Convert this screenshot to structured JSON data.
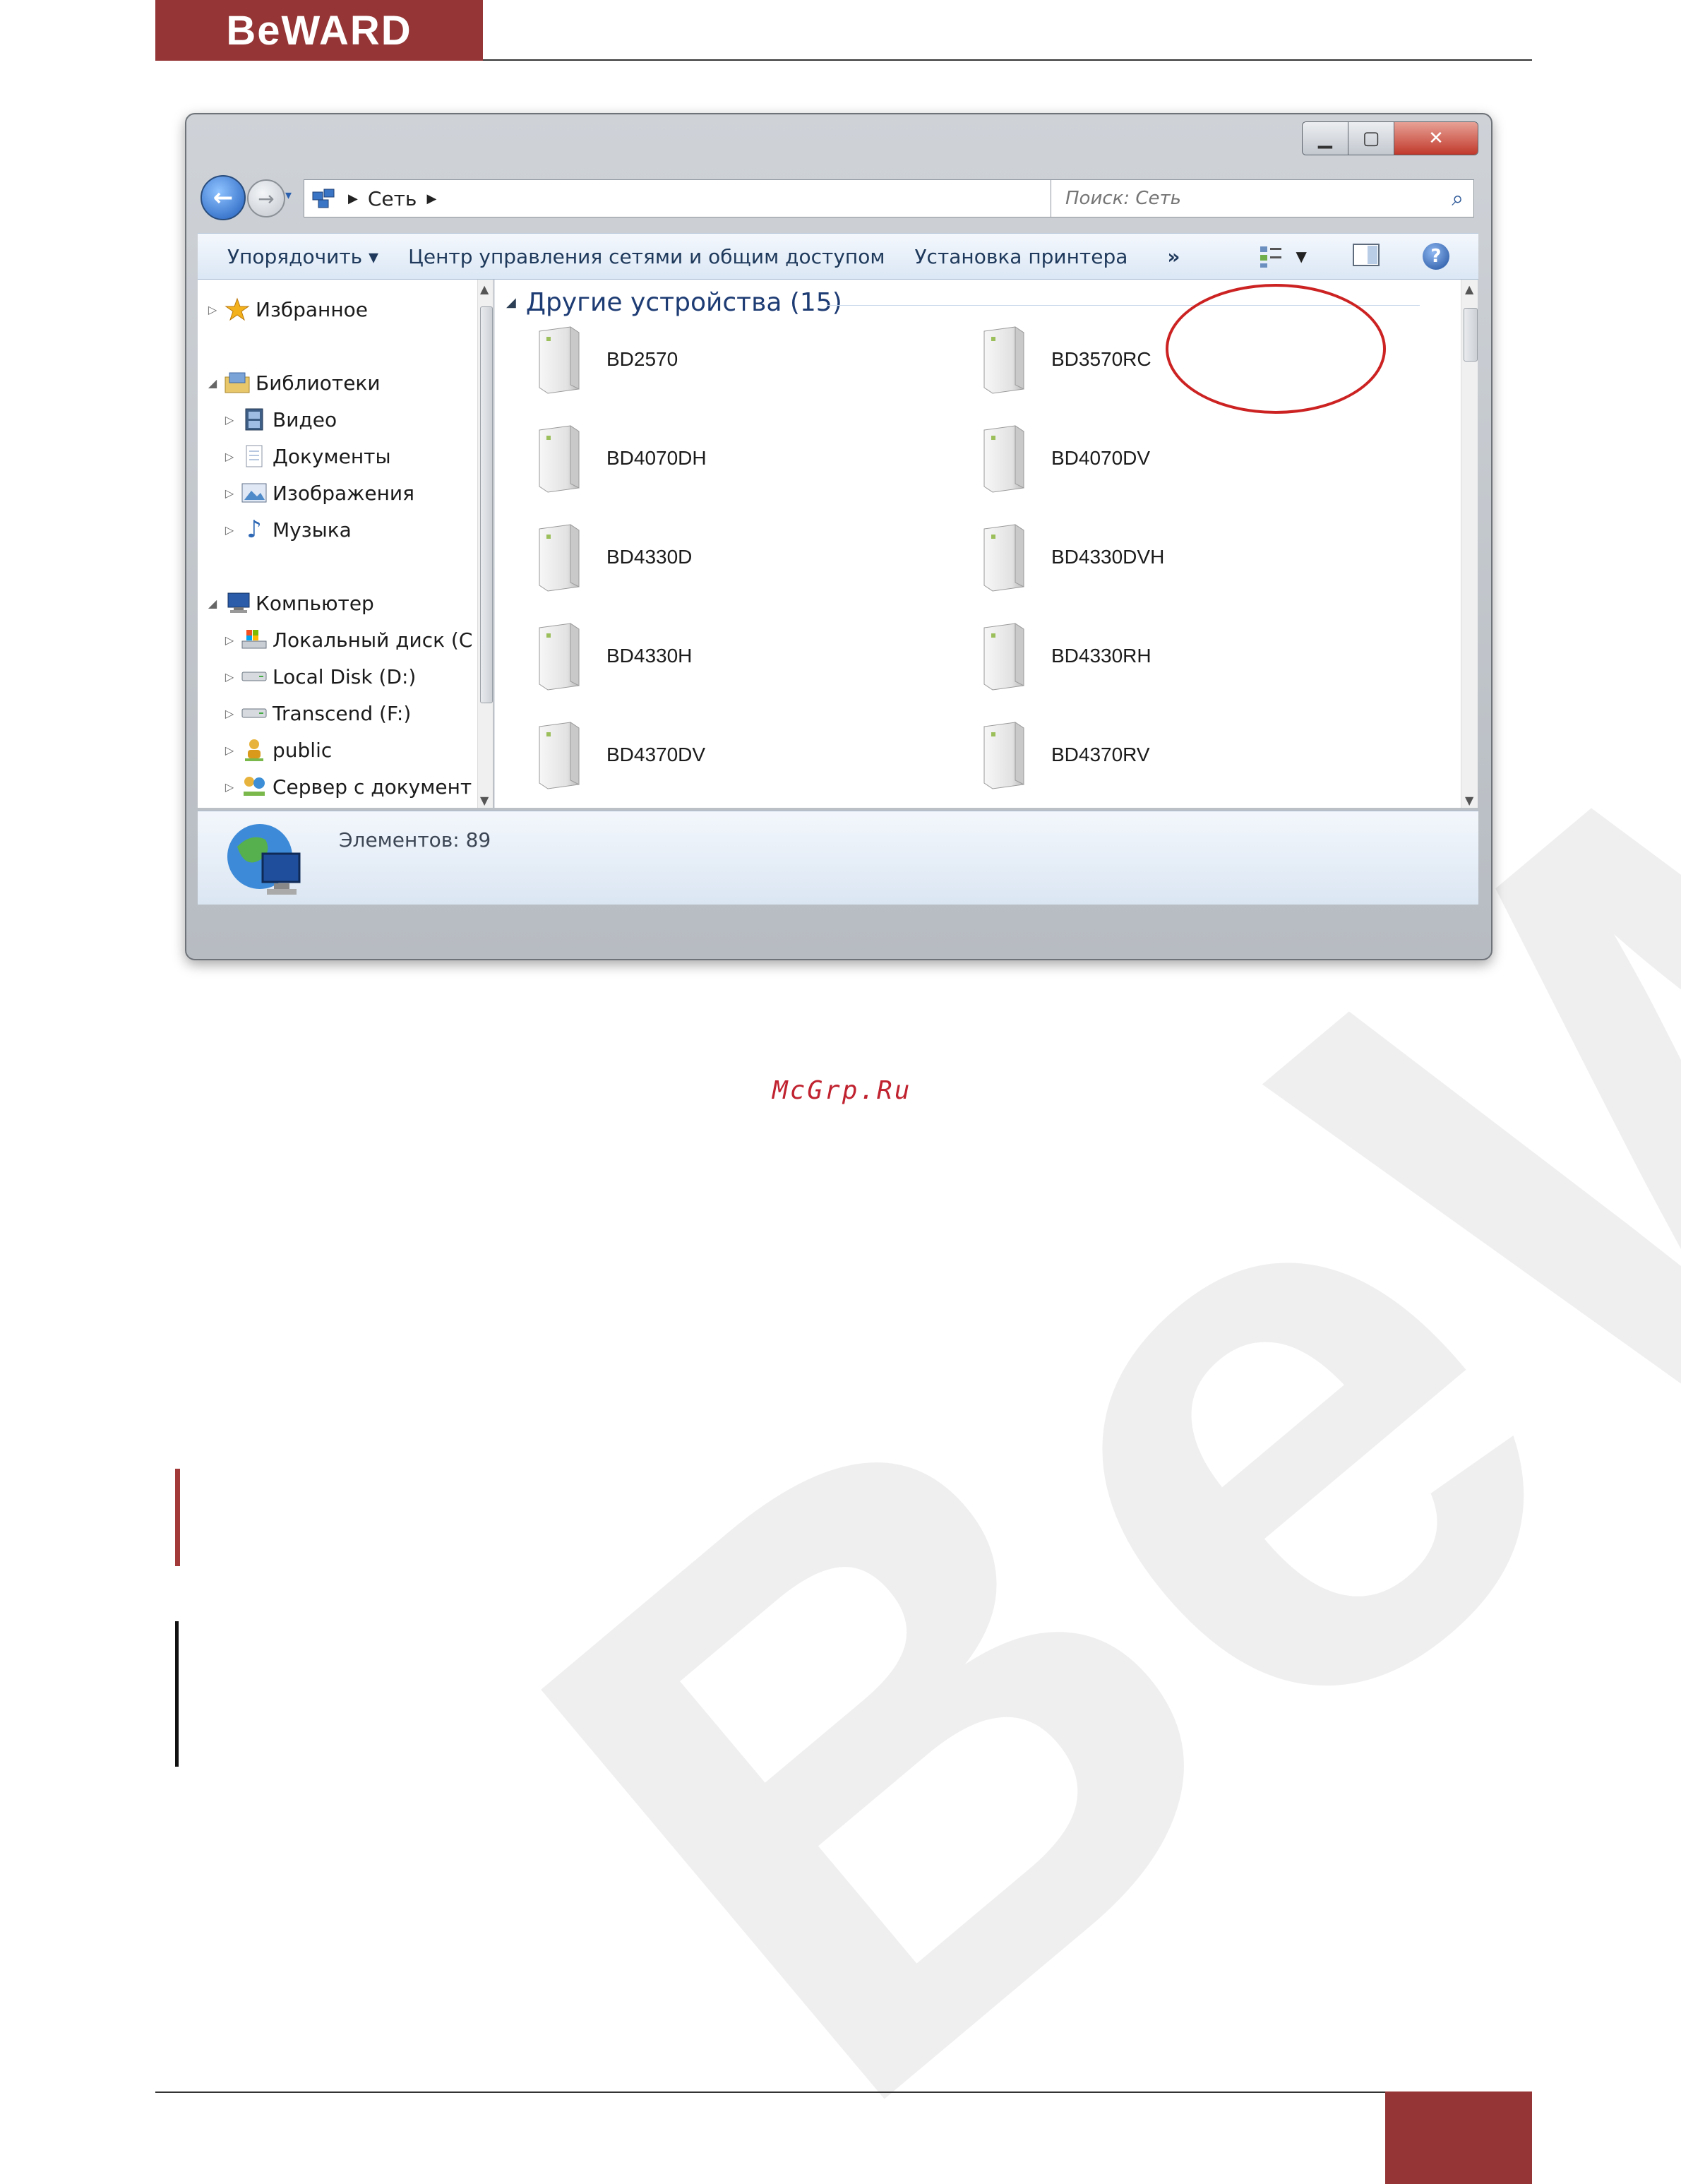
{
  "brand": {
    "logo_text": "BeWARD",
    "accent_color": "#953535"
  },
  "window": {
    "controls": {
      "minimize": "▁",
      "maximize": "▢",
      "close": "✕"
    },
    "nav": {
      "back_icon": "back-arrow-icon",
      "forward_icon": "forward-arrow-icon",
      "breadcrumb": "Сеть",
      "search_placeholder": "Поиск: Сеть"
    },
    "toolbar": {
      "organize": "Упорядочить ▾",
      "network_center": "Центр управления сетями и общим доступом",
      "add_printer": "Установка принтера",
      "more": "»"
    },
    "nav_pane": {
      "items": [
        {
          "label": "Избранное",
          "icon": "star-icon",
          "level": 0
        },
        {
          "label": "Библиотеки",
          "icon": "libraries-icon",
          "level": 0
        },
        {
          "label": "Видео",
          "icon": "video-icon",
          "level": 1
        },
        {
          "label": "Документы",
          "icon": "documents-icon",
          "level": 1
        },
        {
          "label": "Изображения",
          "icon": "pictures-icon",
          "level": 1
        },
        {
          "label": "Музыка",
          "icon": "music-icon",
          "level": 1
        },
        {
          "label": "Компьютер",
          "icon": "computer-icon",
          "level": 0
        },
        {
          "label": "Локальный диск (C",
          "icon": "local-disk-icon",
          "level": 1
        },
        {
          "label": "Local Disk (D:)",
          "icon": "drive-icon",
          "level": 1
        },
        {
          "label": "Transcend (F:)",
          "icon": "drive-icon",
          "level": 1
        },
        {
          "label": "public",
          "icon": "user-folder-icon",
          "level": 1
        },
        {
          "label": "Сервер с документ",
          "icon": "network-server-icon",
          "level": 1
        }
      ]
    },
    "content": {
      "group_title": "Другие устройства (15)",
      "devices": [
        "BD2570",
        "BD3570RC",
        "BD4070DH",
        "BD4070DV",
        "BD4330D",
        "BD4330DVH",
        "BD4330H",
        "BD4330RH",
        "BD4370DV",
        "BD4370RV"
      ],
      "highlighted_device": "BD3570RC"
    },
    "details": {
      "count_text": "Элементов: 89"
    }
  },
  "site_text": "McGrp.Ru"
}
